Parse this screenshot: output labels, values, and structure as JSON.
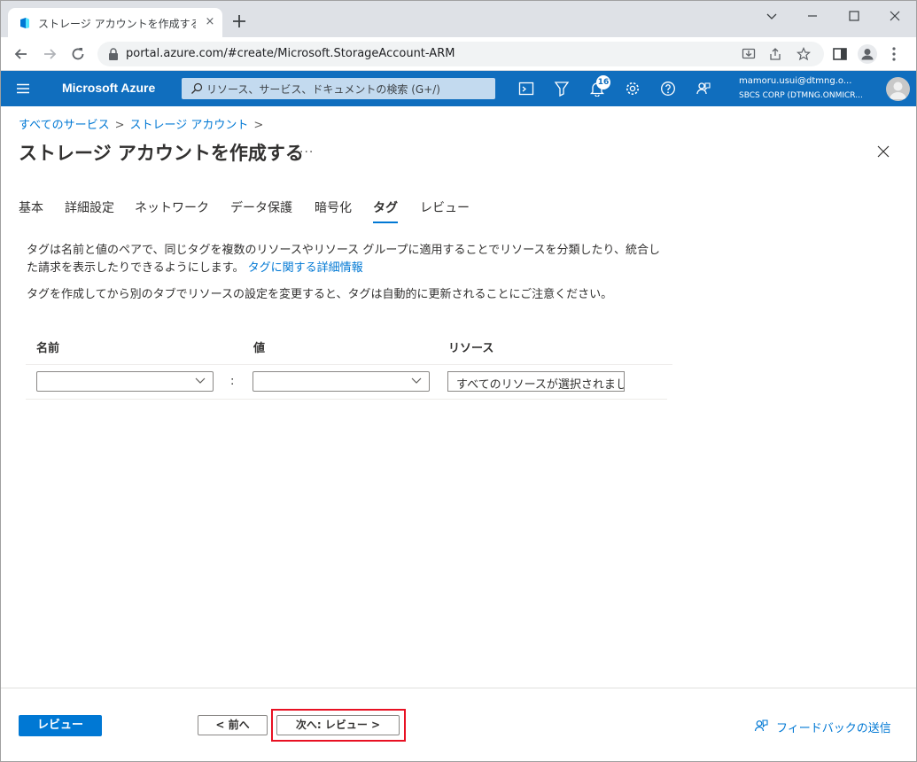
{
  "browser": {
    "tab_title": "ストレージ アカウントを作成する - Mic",
    "tab_close": "×",
    "url": "portal.azure.com/#create/Microsoft.StorageAccount-ARM"
  },
  "azure_header": {
    "brand": "Microsoft Azure",
    "search_placeholder": "リソース、サービス、ドキュメントの検索 (G+/)",
    "notification_count": "16",
    "user_email": "mamoru.usui@dtmng.o...",
    "user_org": "SBCS CORP (DTMNG.ONMICR..."
  },
  "breadcrumb": {
    "items": [
      "すべてのサービス",
      "ストレージ アカウント"
    ],
    "separator": ">"
  },
  "page": {
    "title": "ストレージ アカウントを作成する",
    "more": "..."
  },
  "tabs": [
    {
      "label": "基本"
    },
    {
      "label": "詳細設定"
    },
    {
      "label": "ネットワーク"
    },
    {
      "label": "データ保護"
    },
    {
      "label": "暗号化"
    },
    {
      "label": "タグ"
    },
    {
      "label": "レビュー"
    }
  ],
  "description": {
    "line1": "タグは名前と値のペアで、同じタグを複数のリソースやリソース グループに適用することでリソースを分類したり、統合し",
    "line2": "た請求を表示したりできるようにします。",
    "link": "タグに関する詳細情報",
    "note": "タグを作成してから別のタブでリソースの設定を変更すると、タグは自動的に更新されることにご注意ください。"
  },
  "tag_table": {
    "headers": {
      "name": "名前",
      "value": "値",
      "resource": "リソース"
    },
    "colon": ":",
    "row": {
      "name": "",
      "value": "",
      "resource": "すべてのリソースが選択されまし"
    }
  },
  "footer": {
    "review_button": "レビュー",
    "prev_button": "< 前へ",
    "next_button": "次へ: レビュー >",
    "feedback": "フィードバックの送信"
  },
  "colors": {
    "azure_blue": "#106ebe",
    "link_blue": "#0078d4",
    "highlight_red": "#e81123"
  }
}
